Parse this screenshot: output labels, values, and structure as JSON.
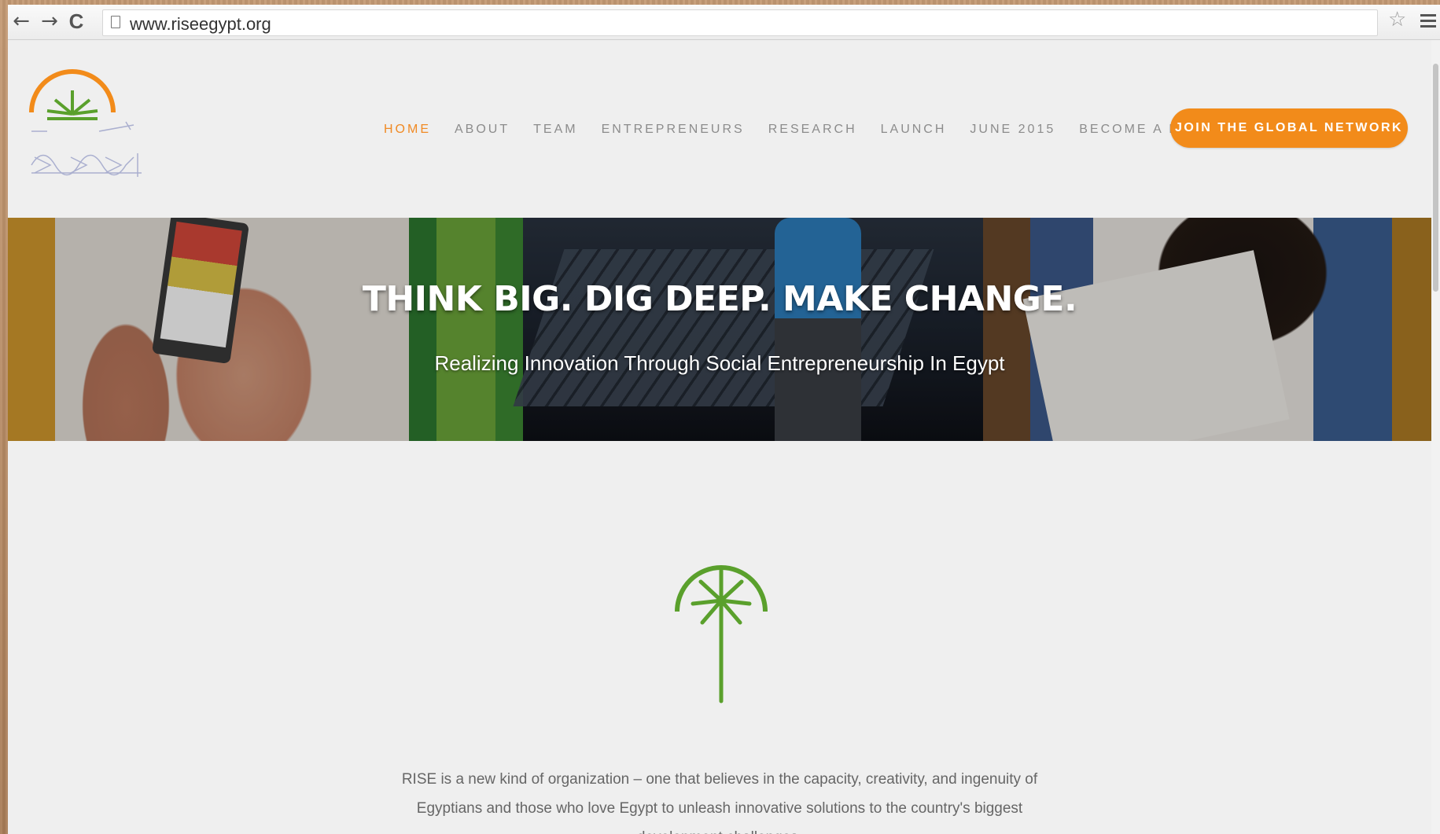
{
  "browser": {
    "url": "www.riseegypt.org",
    "back_icon": "←",
    "forward_icon": "→",
    "reload_icon": "C",
    "star_icon": "☆"
  },
  "header": {
    "nav": [
      {
        "label": "HOME",
        "active": true
      },
      {
        "label": "ABOUT"
      },
      {
        "label": "TEAM"
      },
      {
        "label": "ENTREPRENEURS"
      },
      {
        "label": "RESEARCH"
      },
      {
        "label": "LAUNCH"
      },
      {
        "label": "JUNE 2015"
      },
      {
        "label": "BECOME A MEMBER"
      }
    ],
    "cta_label": "JOIN THE GLOBAL NETWORK"
  },
  "hero": {
    "title": "THINK BIG. DIG DEEP. MAKE CHANGE.",
    "subtitle": "Realizing Innovation Through Social Entrepreneurship In Egypt"
  },
  "intro": {
    "text": "RISE is a new kind of organization – one that believes in the capacity, creativity, and ingenuity of Egyptians and those who love Egypt to unleash innovative solutions to the country's biggest development challenges."
  },
  "colors": {
    "accent_orange": "#f28b1a",
    "logo_green": "#5aa02c",
    "nav_gray": "#8c8c8c"
  }
}
